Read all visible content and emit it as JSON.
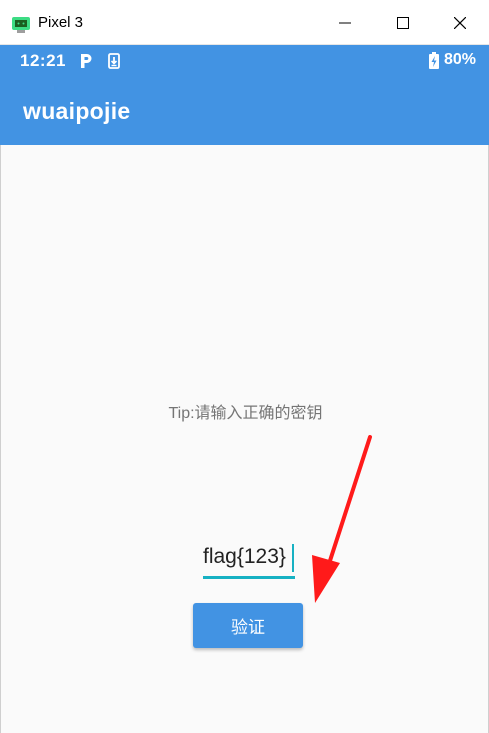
{
  "window": {
    "title": "Pixel 3",
    "app_icon": "android-emulator-icon",
    "controls": [
      "minimize-icon",
      "maximize-icon",
      "close-icon"
    ]
  },
  "status_bar": {
    "time": "12:21",
    "icons": [
      "parking-icon",
      "download-icon"
    ],
    "battery": "80%"
  },
  "app_bar": {
    "title": "wuaipojie"
  },
  "main": {
    "tip": "Tip:请输入正确的密钥",
    "input_value": "flag{123}",
    "verify_button": "验证"
  },
  "annotation": {
    "arrow_color": "#ff1a1a"
  },
  "colors": {
    "primary": "#4293e3",
    "accent": "#17b1c3"
  }
}
